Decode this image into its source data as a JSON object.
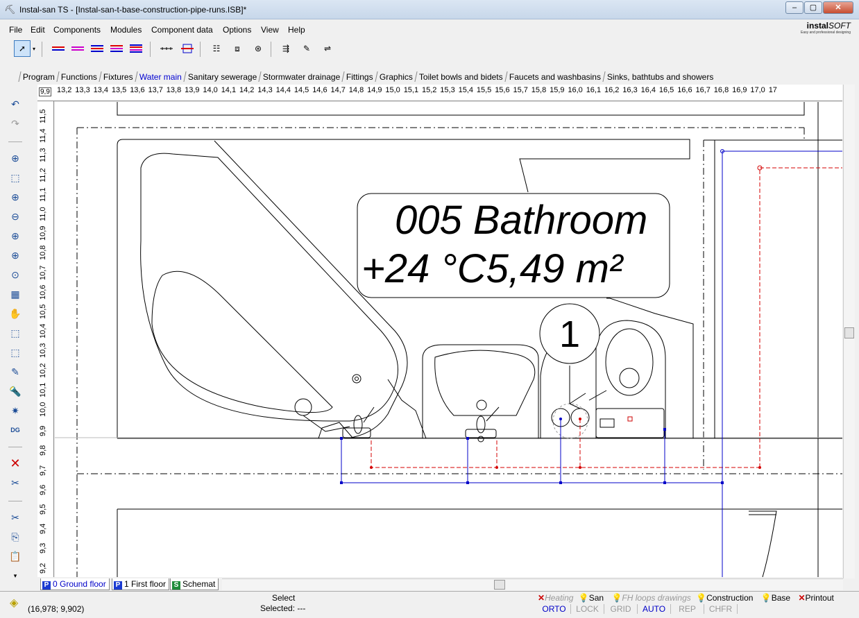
{
  "window": {
    "title": "Instal-san TS - [Instal-san-t-base-construction-pipe-runs.ISB]*",
    "minimize": "‒",
    "maximize": "▢",
    "close": "✕"
  },
  "menu": [
    "File",
    "Edit",
    "Components",
    "Modules",
    "Component data",
    "Options",
    "View",
    "Help"
  ],
  "logo": {
    "brand_a": "instal",
    "brand_b": "SOFT",
    "tagline": "Easy and professional designing"
  },
  "module_tabs": [
    "Program",
    "Functions",
    "Fixtures",
    "Water main",
    "Sanitary sewerage",
    "Stormwater drainage",
    "Fittings",
    "Graphics",
    "Toilet bowls and bidets",
    "Faucets and washbasins",
    "Sinks, bathtubs and showers"
  ],
  "active_module": "Water main",
  "ruler": {
    "corner": "9,9",
    "h_ticks": [
      "13,2",
      "13,3",
      "13,4",
      "13,5",
      "13,6",
      "13,7",
      "13,8",
      "13,9",
      "14,0",
      "14,1",
      "14,2",
      "14,3",
      "14,4",
      "14,5",
      "14,6",
      "14,7",
      "14,8",
      "14,9",
      "15,0",
      "15,1",
      "15,2",
      "15,3",
      "15,4",
      "15,5",
      "15,6",
      "15,7",
      "15,8",
      "15,9",
      "16,0",
      "16,1",
      "16,2",
      "16,3",
      "16,4",
      "16,5",
      "16,6",
      "16,7",
      "16,8",
      "16,9",
      "17,0",
      "17"
    ],
    "v_ticks": [
      "11,5",
      "11,4",
      "11,3",
      "11,2",
      "11,1",
      "11,0",
      "10,9",
      "10,8",
      "10,7",
      "10,6",
      "10,5",
      "10,4",
      "10,3",
      "10,2",
      "10,1",
      "10,0",
      "9,9",
      "9,8",
      "9,7",
      "9,6",
      "9,5",
      "9,4",
      "9,3",
      "9,2"
    ]
  },
  "drawing": {
    "room_name": "005 Bathroom",
    "room_info": "+24 °C5,49 m²",
    "marker": "1"
  },
  "floors": [
    {
      "badge": "P",
      "label": "0 Ground floor",
      "color": "#1b3bd1"
    },
    {
      "badge": "P",
      "label": "1 First floor",
      "color": "#1b3bd1"
    },
    {
      "badge": "S",
      "label": "Schemat",
      "color": "#1e8c3a"
    }
  ],
  "status": {
    "coords": "(16,978; 9,902)",
    "mode": "Select",
    "selected": "Selected: ---",
    "layers": [
      "Heating",
      "San",
      "FH loops drawings",
      "Construction",
      "Base",
      "Printout"
    ],
    "flags": [
      "ORTO",
      "LOCK",
      "GRID",
      "AUTO",
      "REP",
      "CHFR"
    ]
  }
}
